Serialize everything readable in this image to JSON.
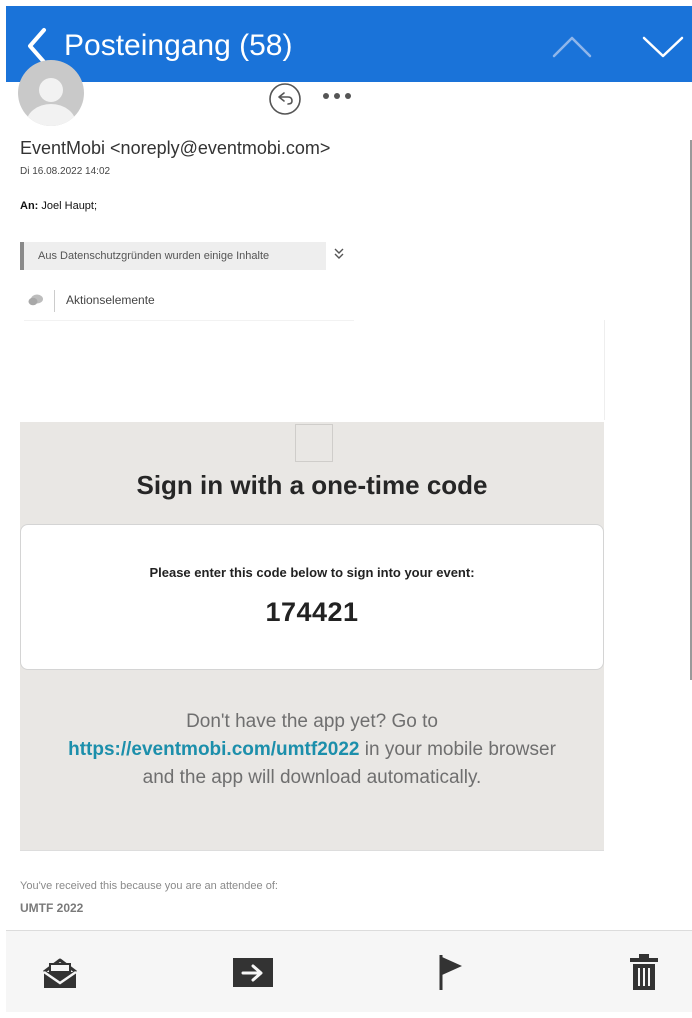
{
  "header": {
    "title": "Posteingang (58)",
    "background": "#1a73d9",
    "back_icon": "chevron-left-icon",
    "prev_icon": "chevron-up-icon",
    "next_icon": "chevron-down-icon"
  },
  "message": {
    "sender": "EventMobi <noreply@eventmobi.com>",
    "date": "Di 16.08.2022 14:02",
    "to_label": "An:",
    "to_value": "Joel Haupt;",
    "privacy_notice": "Aus Datenschutzgründen wurden einige Inhalte",
    "privacy_expand_icon": "double-chevron-down-icon",
    "actions_label": "Aktionselemente"
  },
  "email": {
    "heading": "Sign in with a one-time code",
    "code_intro": "Please enter this code below to sign into your event:",
    "code": "174421",
    "download_prefix": "Don't have the app yet? Go to",
    "download_link": "https://eventmobi.com/umtf2022",
    "download_suffix_1": "in your mobile browser",
    "download_suffix_2": "and the app will download automatically.",
    "footer_note": "You've received this because you are an attendee of:",
    "footer_event": "UMTF 2022",
    "link_color": "#1c8fab"
  },
  "toolbar": {
    "items": [
      {
        "icon": "mark-read-icon"
      },
      {
        "icon": "move-to-folder-icon"
      },
      {
        "icon": "flag-icon"
      },
      {
        "icon": "trash-icon"
      }
    ]
  }
}
